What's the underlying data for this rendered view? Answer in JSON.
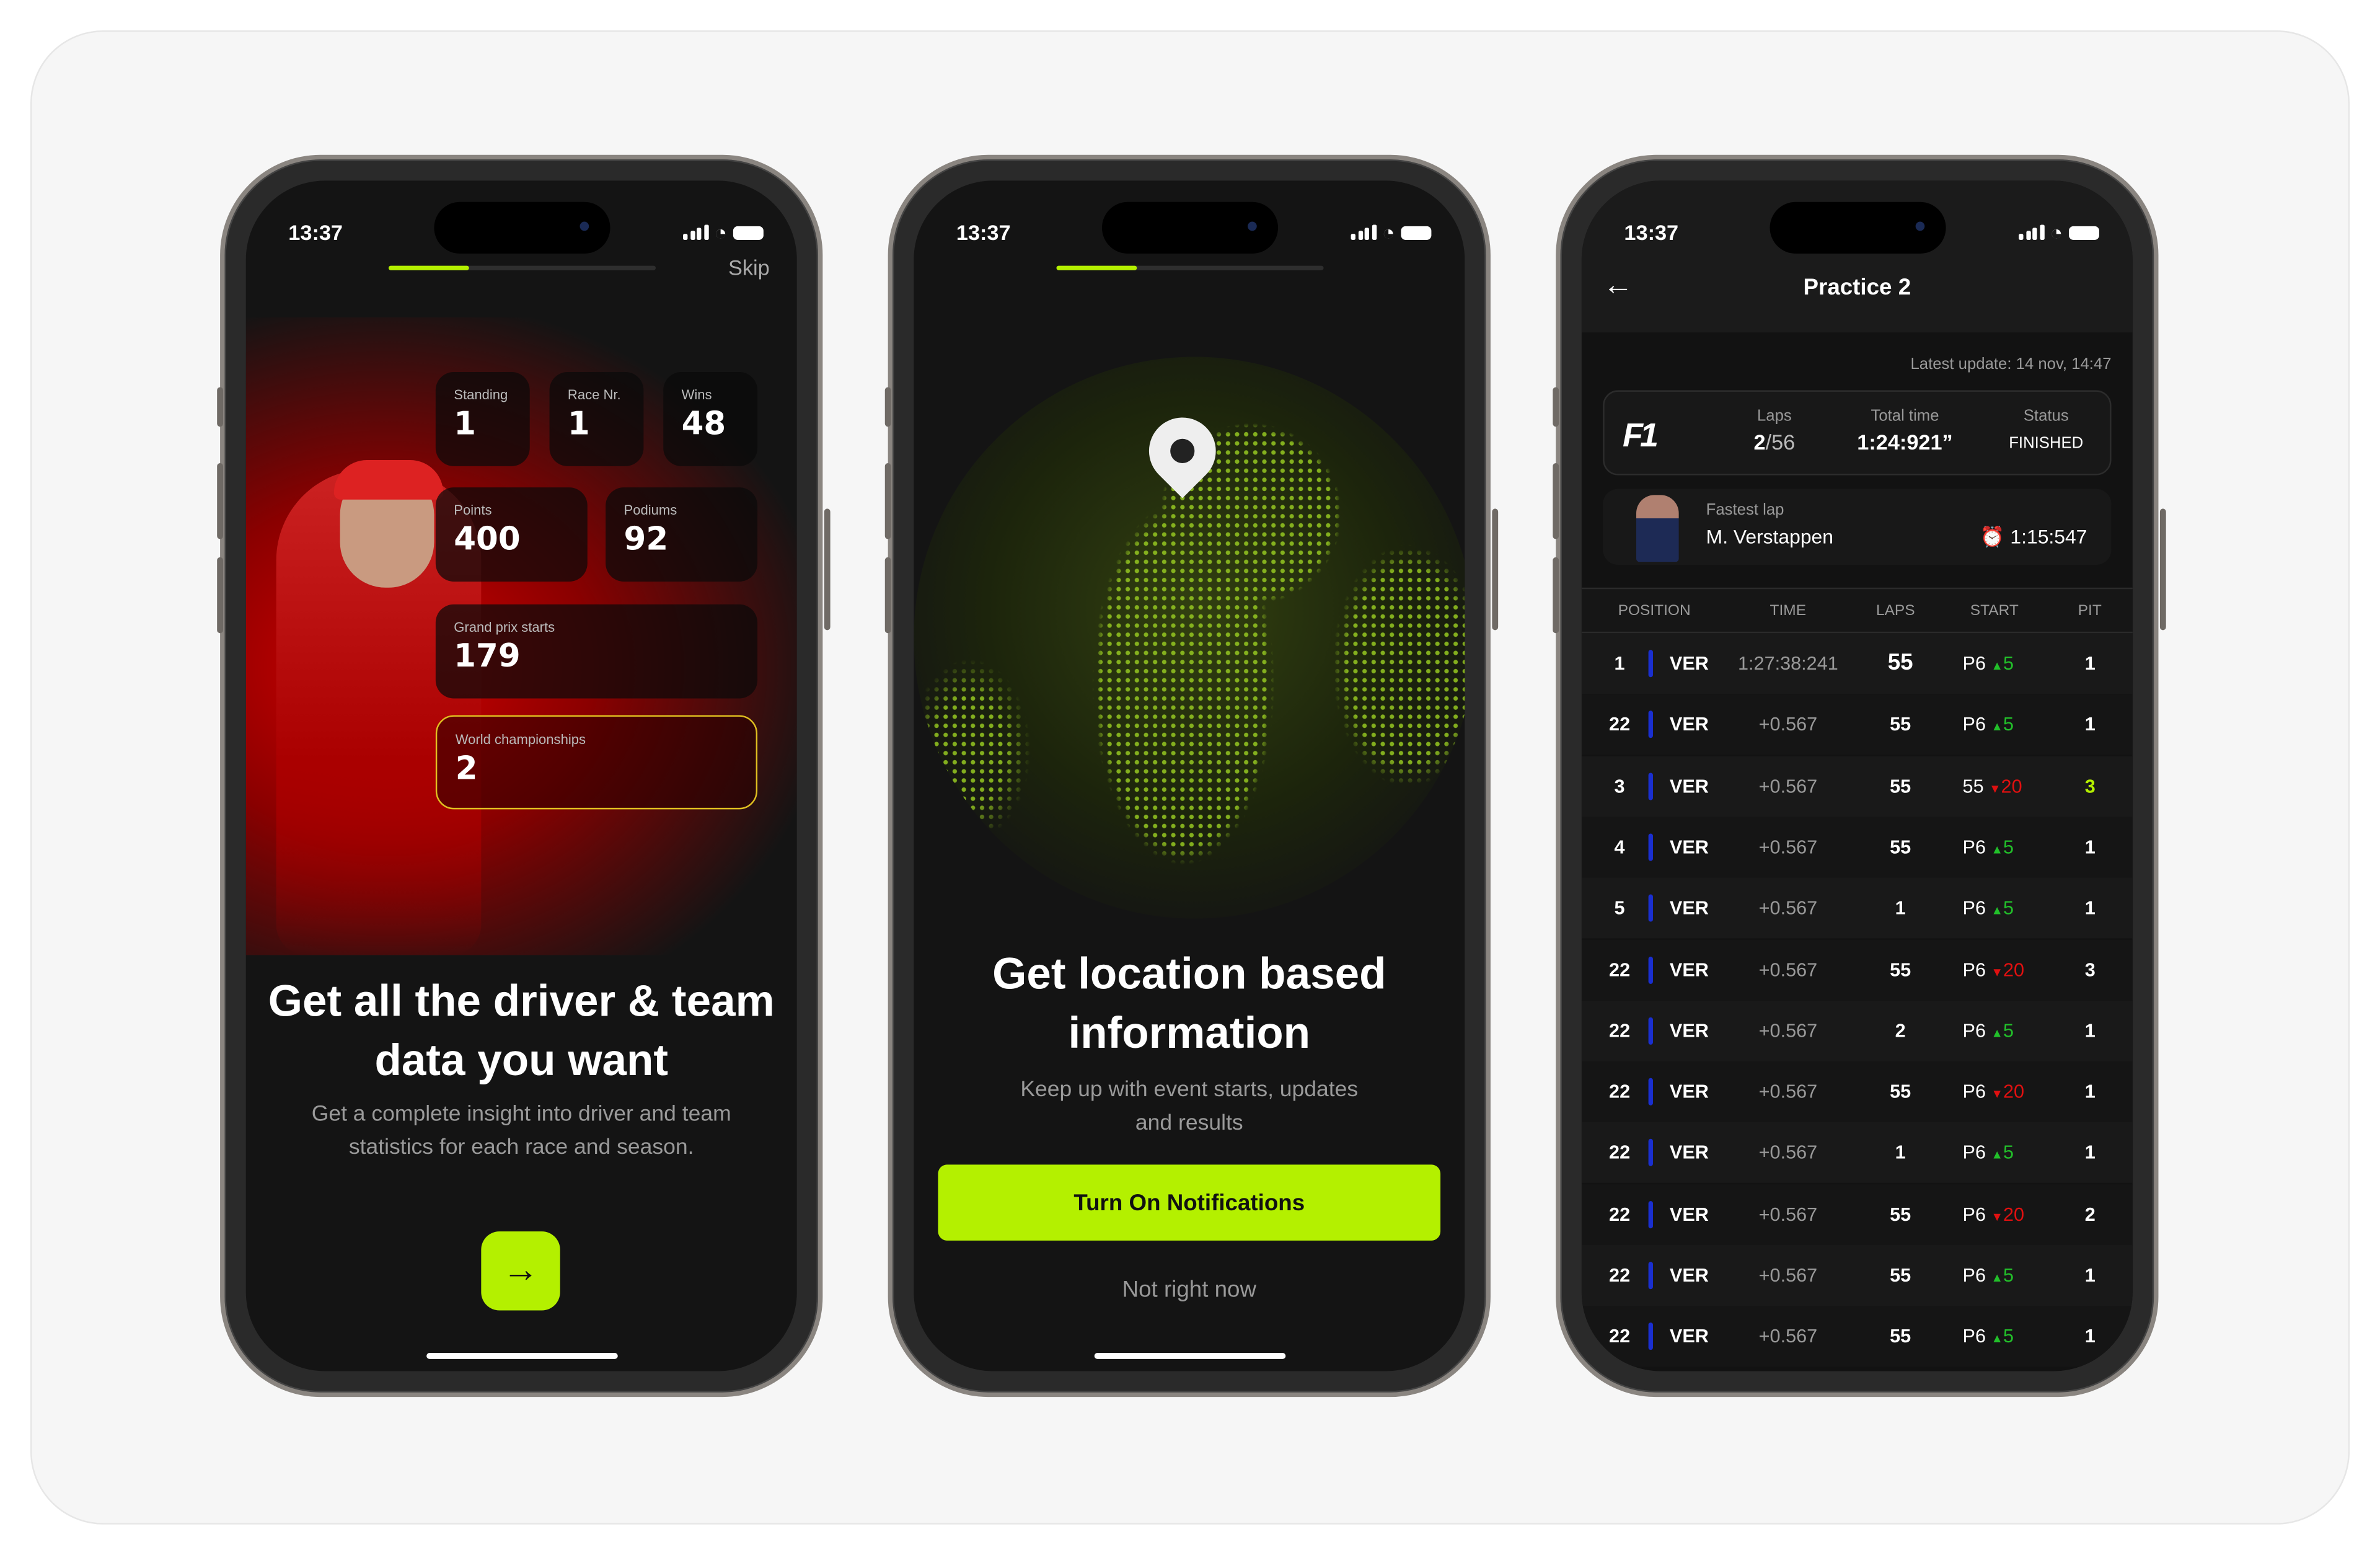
{
  "status_time": "13:37",
  "onboarding1": {
    "skip": "Skip",
    "progress": 0.3,
    "stats": [
      {
        "label": "Standing",
        "value": "1"
      },
      {
        "label": "Race Nr.",
        "value": "1"
      },
      {
        "label": "Wins",
        "value": "48"
      },
      {
        "label": "Points",
        "value": "400"
      },
      {
        "label": "Podiums",
        "value": "92"
      },
      {
        "label": "Grand prix starts",
        "value": "179"
      },
      {
        "label": "World championships",
        "value": "2"
      }
    ],
    "title": "Get all the driver & team data you want",
    "subtitle": "Get a complete insight into driver and team statistics for each race and season.",
    "next_icon": "arrow-right-icon"
  },
  "onboarding2": {
    "progress": 0.3,
    "title": "Get location based information",
    "subtitle": "Keep up with event starts, updates and results",
    "cta": "Turn On Notifications",
    "secondary": "Not right now"
  },
  "session": {
    "title": "Practice 2",
    "latest_update": "Latest update: 14 nov, 14:47",
    "summary": {
      "laps_label": "Laps",
      "laps_done": "2",
      "laps_total": "/56",
      "total_label": "Total time",
      "total_value": "1:24:921”",
      "status_label": "Status",
      "status_value": "FINISHED"
    },
    "fastest": {
      "label": "Fastest lap",
      "driver": "M. Verstappen",
      "time": "1:15:547"
    },
    "columns": [
      "POSITION",
      "TIME",
      "LAPS",
      "START",
      "PIT"
    ],
    "rows": [
      {
        "pos": "1",
        "driver": "VER",
        "time": "1:27:38:241",
        "laps": "55",
        "start": "P6",
        "dir": "up",
        "delta": "5",
        "pit": "1"
      },
      {
        "pos": "22",
        "driver": "VER",
        "time": "+0.567",
        "laps": "55",
        "start": "P6",
        "dir": "up",
        "delta": "5",
        "pit": "1"
      },
      {
        "pos": "3",
        "driver": "VER",
        "time": "+0.567",
        "laps": "55",
        "start": "55",
        "dir": "down",
        "delta": "20",
        "pit": "3",
        "pit_highlight": true
      },
      {
        "pos": "4",
        "driver": "VER",
        "time": "+0.567",
        "laps": "55",
        "start": "P6",
        "dir": "up",
        "delta": "5",
        "pit": "1"
      },
      {
        "pos": "5",
        "driver": "VER",
        "time": "+0.567",
        "laps": "1",
        "start": "P6",
        "dir": "up",
        "delta": "5",
        "pit": "1"
      },
      {
        "pos": "22",
        "driver": "VER",
        "time": "+0.567",
        "laps": "55",
        "start": "P6",
        "dir": "down",
        "delta": "20",
        "pit": "3"
      },
      {
        "pos": "22",
        "driver": "VER",
        "time": "+0.567",
        "laps": "2",
        "start": "P6",
        "dir": "up",
        "delta": "5",
        "pit": "1"
      },
      {
        "pos": "22",
        "driver": "VER",
        "time": "+0.567",
        "laps": "55",
        "start": "P6",
        "dir": "down",
        "delta": "20",
        "pit": "1"
      },
      {
        "pos": "22",
        "driver": "VER",
        "time": "+0.567",
        "laps": "1",
        "start": "P6",
        "dir": "up",
        "delta": "5",
        "pit": "1"
      },
      {
        "pos": "22",
        "driver": "VER",
        "time": "+0.567",
        "laps": "55",
        "start": "P6",
        "dir": "down",
        "delta": "20",
        "pit": "2"
      },
      {
        "pos": "22",
        "driver": "VER",
        "time": "+0.567",
        "laps": "55",
        "start": "P6",
        "dir": "up",
        "delta": "5",
        "pit": "1"
      },
      {
        "pos": "22",
        "driver": "VER",
        "time": "+0.567",
        "laps": "55",
        "start": "P6",
        "dir": "up",
        "delta": "5",
        "pit": "1"
      }
    ]
  },
  "colors": {
    "accent": "#b4f000",
    "up": "#22c02a",
    "down": "#e01010",
    "team": "#1a2fd0",
    "fastest": "#9b3cf0",
    "highlight_border": "#e0c020"
  }
}
